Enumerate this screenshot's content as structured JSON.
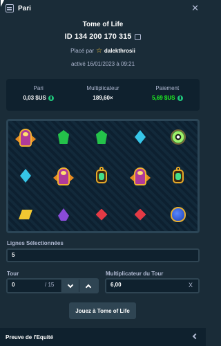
{
  "header": {
    "title": "Pari",
    "icon": "bet-slip-icon",
    "close_icon": "close-icon"
  },
  "bet": {
    "game": "Tome of Life",
    "id": "ID 134 200 170 315",
    "placed_by_prefix": "Placé par",
    "username": "dalekthrosii",
    "activated": "activé 16/01/2023 à 09:21"
  },
  "stats": {
    "bet_label": "Pari",
    "bet_value": "0,03 $US",
    "multiplier_label": "Multiplicateur",
    "multiplier_value": "189,60×",
    "payout_label": "Paiement",
    "payout_value": "5,69 $US"
  },
  "board": {
    "rows": [
      [
        "wild",
        "green-gem",
        "green-gem",
        "cyan-gem",
        "amulet"
      ],
      [
        "cyan-gem",
        "wild",
        "amulet",
        "wild",
        "amulet"
      ],
      [
        "yellow-gem",
        "purple-gem",
        "red-gem",
        "red-gem",
        "beetle"
      ]
    ],
    "secondary_rows": [
      [
        "orb"
      ]
    ]
  },
  "form": {
    "lines_label": "Lignes Sélectionnées",
    "lines_value": "5",
    "tour_label": "Tour",
    "tour_value": "0",
    "tour_total": "/ 15",
    "round_multiplier_label": "Multiplicateur du Tour",
    "round_multiplier_value": "6,00",
    "round_multiplier_suffix": "X"
  },
  "play_button": "Jouez à Tome of Life",
  "footer": {
    "label": "Preuve de l'Equité"
  },
  "colors": {
    "background": "#1a2c38",
    "panel": "#0f212e",
    "payout_green": "#1fff20",
    "button": "#2f4553"
  }
}
